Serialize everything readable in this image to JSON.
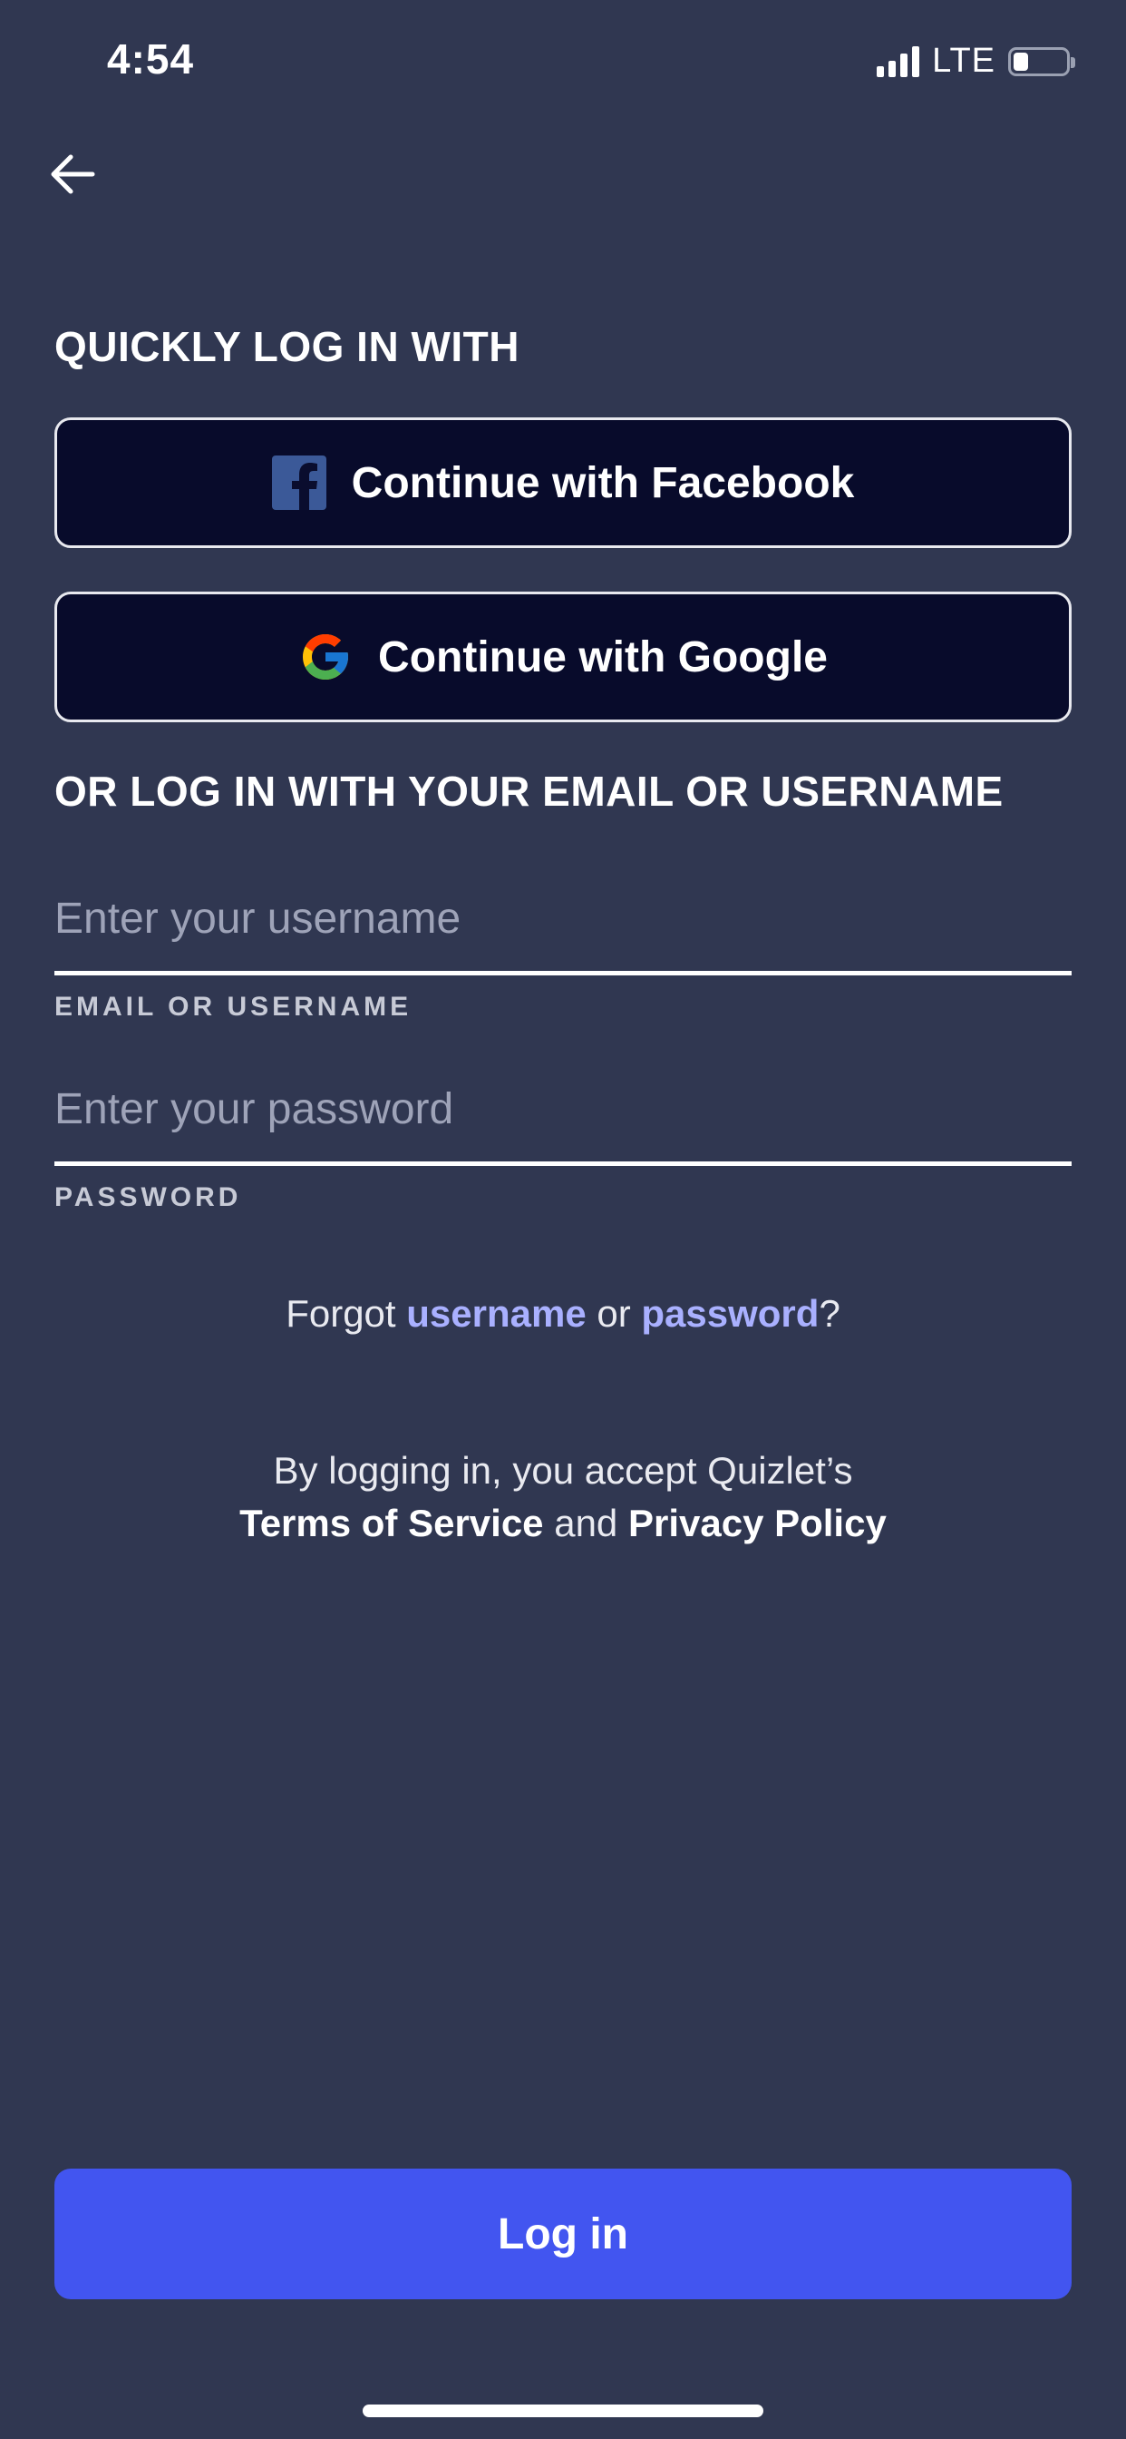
{
  "status_bar": {
    "time": "4:54",
    "network": "LTE"
  },
  "header": {
    "back_icon": "arrow-left-icon"
  },
  "quick_login": {
    "heading": "QUICKLY LOG IN WITH",
    "facebook_label": "Continue with Facebook",
    "google_label": "Continue with Google"
  },
  "email_login": {
    "heading": "OR LOG IN WITH YOUR EMAIL OR USERNAME",
    "username_placeholder": "Enter your username",
    "username_label": "EMAIL OR USERNAME",
    "password_placeholder": "Enter your password",
    "password_label": "PASSWORD"
  },
  "forgot": {
    "prefix": "Forgot ",
    "username_link": "username",
    "middle": " or ",
    "password_link": "password",
    "suffix": "?"
  },
  "terms": {
    "line1": "By logging in, you accept Quizlet’s",
    "tos_link": "Terms of Service",
    "and": " and ",
    "privacy_link": "Privacy Policy"
  },
  "login_button": "Log in",
  "colors": {
    "background": "#303751",
    "social_button_bg": "#080b2b",
    "primary": "#4255f0",
    "link_accent": "#a9b0ff",
    "facebook_blue": "#3b5998"
  }
}
